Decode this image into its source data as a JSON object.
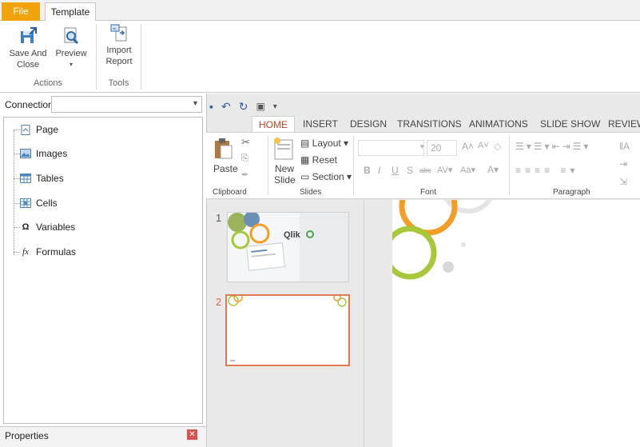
{
  "app_tabs": {
    "file": "File",
    "template": "Template"
  },
  "ribbon": {
    "save_close": "Save And Close",
    "preview": "Preview",
    "preview_arrow": "▾",
    "import_report": "Import Report",
    "group_actions": "Actions",
    "group_tools": "Tools"
  },
  "connection": {
    "label": "Connection",
    "value": ""
  },
  "tree": {
    "items": [
      {
        "label": "Page",
        "icon": "page-icon"
      },
      {
        "label": "Images",
        "icon": "images-icon"
      },
      {
        "label": "Tables",
        "icon": "tables-icon"
      },
      {
        "label": "Cells",
        "icon": "cells-icon"
      },
      {
        "label": "Variables",
        "icon": "omega-icon",
        "glyph": "Ω"
      },
      {
        "label": "Formulas",
        "icon": "fx-icon",
        "glyph": "fx"
      }
    ]
  },
  "properties": {
    "label": "Properties"
  },
  "powerpoint": {
    "tabs": [
      "HOME",
      "INSERT",
      "DESIGN",
      "TRANSITIONS",
      "ANIMATIONS",
      "SLIDE SHOW",
      "REVIEW"
    ],
    "active_tab": "HOME",
    "paste": "Paste",
    "new_slide": "New Slide",
    "layout": "Layout",
    "reset": "Reset",
    "section": "Section",
    "font_size": "20",
    "group_clipboard": "Clipboard",
    "group_slides": "Slides",
    "group_font": "Font",
    "group_paragraph": "Paragraph"
  },
  "slides": [
    {
      "number": "1",
      "logo_text": "Qlik"
    },
    {
      "number": "2"
    }
  ],
  "colors": {
    "accent_orange": "#f0a30a",
    "selected_border": "#e07a55",
    "ring_green": "#a8c83c",
    "ring_orange": "#f39c26"
  }
}
